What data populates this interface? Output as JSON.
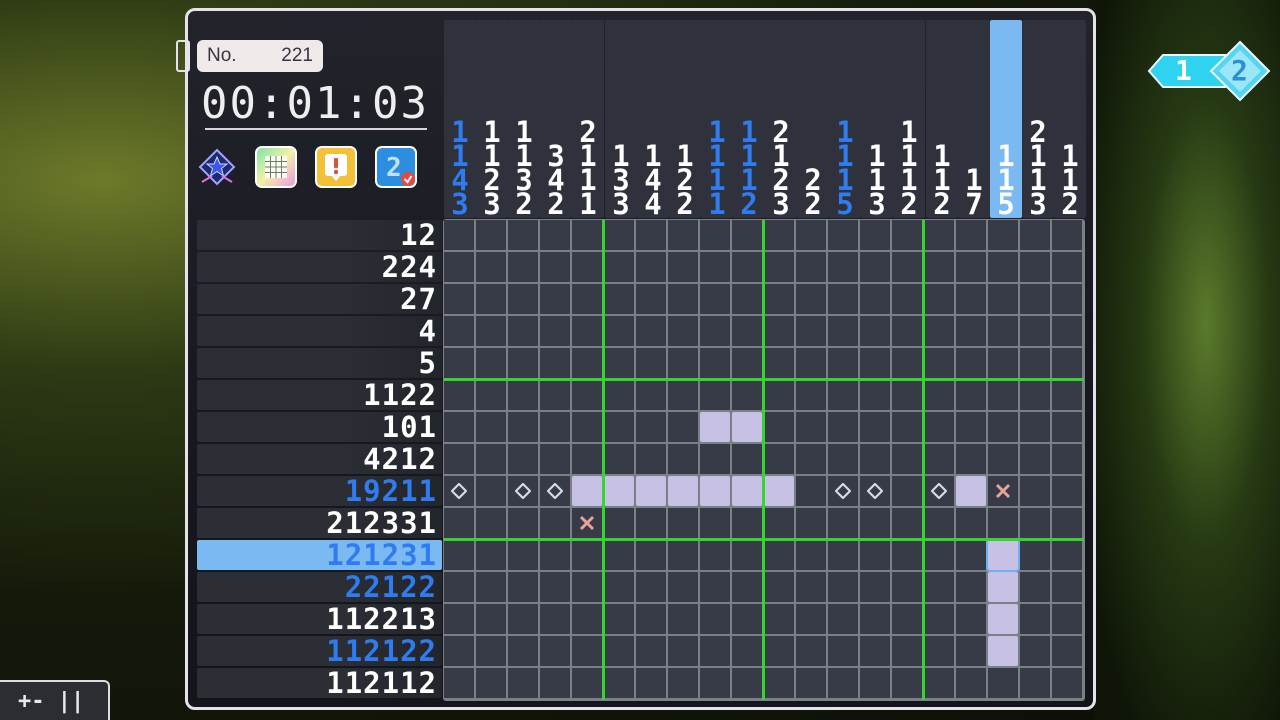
{
  "puzzle": {
    "label": "No.",
    "number": "221"
  },
  "timer": "00:01:03",
  "toolbar": {
    "icons": [
      "star-badge-icon",
      "grid-icon",
      "hint-icon",
      "check-icon"
    ]
  },
  "page_switcher": {
    "current": "1",
    "next": "2"
  },
  "bottom_controls": {
    "label": "+- ||"
  },
  "column_clues": [
    {
      "nums": [
        "1",
        "1",
        "4",
        "3"
      ],
      "color": "blue"
    },
    {
      "nums": [
        "1",
        "1",
        "2",
        "3"
      ],
      "color": "white"
    },
    {
      "nums": [
        "1",
        "1",
        "3",
        "2"
      ],
      "color": "white"
    },
    {
      "nums": [
        "3",
        "4",
        "2"
      ],
      "color": "white"
    },
    {
      "nums": [
        "2",
        "1",
        "1",
        "1"
      ],
      "color": "white"
    },
    {
      "nums": [
        "1",
        "3",
        "3"
      ],
      "color": "white"
    },
    {
      "nums": [
        "1",
        "4",
        "4"
      ],
      "color": "white"
    },
    {
      "nums": [
        "1",
        "2",
        "2"
      ],
      "color": "white"
    },
    {
      "nums": [
        "1",
        "1",
        "1",
        "1"
      ],
      "color": "blue"
    },
    {
      "nums": [
        "1",
        "1",
        "1",
        "2"
      ],
      "color": "blue"
    },
    {
      "nums": [
        "2",
        "1",
        "2",
        "3"
      ],
      "color": "white"
    },
    {
      "nums": [
        "2",
        "2"
      ],
      "color": "white"
    },
    {
      "nums": [
        "1",
        "1",
        "1",
        "5"
      ],
      "color": "blue"
    },
    {
      "nums": [
        "1",
        "1",
        "3"
      ],
      "color": "white"
    },
    {
      "nums": [
        "1",
        "1",
        "1",
        "2"
      ],
      "color": "white"
    },
    {
      "nums": [
        "1",
        "1",
        "2"
      ],
      "color": "white"
    },
    {
      "nums": [
        "1",
        "7"
      ],
      "color": "white"
    },
    {
      "nums": [
        "1",
        "1",
        "5"
      ],
      "color": "white",
      "highlight": true
    },
    {
      "nums": [
        "2",
        "1",
        "1",
        "3"
      ],
      "color": "white"
    },
    {
      "nums": [
        "1",
        "1",
        "2"
      ],
      "color": "white"
    }
  ],
  "row_clues": [
    {
      "text": "12",
      "color": "white"
    },
    {
      "text": "224",
      "color": "white"
    },
    {
      "text": "27",
      "color": "white"
    },
    {
      "text": "4",
      "color": "white"
    },
    {
      "text": "5",
      "color": "white"
    },
    {
      "text": "1122",
      "color": "white"
    },
    {
      "text": "101",
      "color": "white"
    },
    {
      "text": "4212",
      "color": "white"
    },
    {
      "text": "19211",
      "color": "blue"
    },
    {
      "text": "212331",
      "color": "white"
    },
    {
      "text": "121231",
      "color": "blue",
      "highlight": true
    },
    {
      "text": "22122",
      "color": "blue"
    },
    {
      "text": "112213",
      "color": "white"
    },
    {
      "text": "112122",
      "color": "blue"
    },
    {
      "text": "112112",
      "color": "white"
    }
  ],
  "grid": {
    "rows": 15,
    "cols": 20,
    "filled": [
      [
        6,
        8
      ],
      [
        6,
        9
      ],
      [
        8,
        4
      ],
      [
        8,
        5
      ],
      [
        8,
        6
      ],
      [
        8,
        7
      ],
      [
        8,
        8
      ],
      [
        8,
        9
      ],
      [
        8,
        10
      ],
      [
        8,
        16
      ],
      [
        10,
        17
      ],
      [
        11,
        17
      ],
      [
        12,
        17
      ],
      [
        13,
        17
      ]
    ],
    "dots": [
      [
        8,
        0
      ],
      [
        8,
        2
      ],
      [
        8,
        3
      ],
      [
        8,
        12
      ],
      [
        8,
        13
      ],
      [
        8,
        15
      ]
    ],
    "crosses": [
      [
        8,
        17
      ],
      [
        9,
        4
      ]
    ],
    "cursor": [
      10,
      17
    ]
  },
  "colors": {
    "blue": "#2f7bf0",
    "white": "#ffffff",
    "highlight": "#7ab9f2",
    "filled": "#c7c1e6",
    "guide": "#36d42e"
  }
}
